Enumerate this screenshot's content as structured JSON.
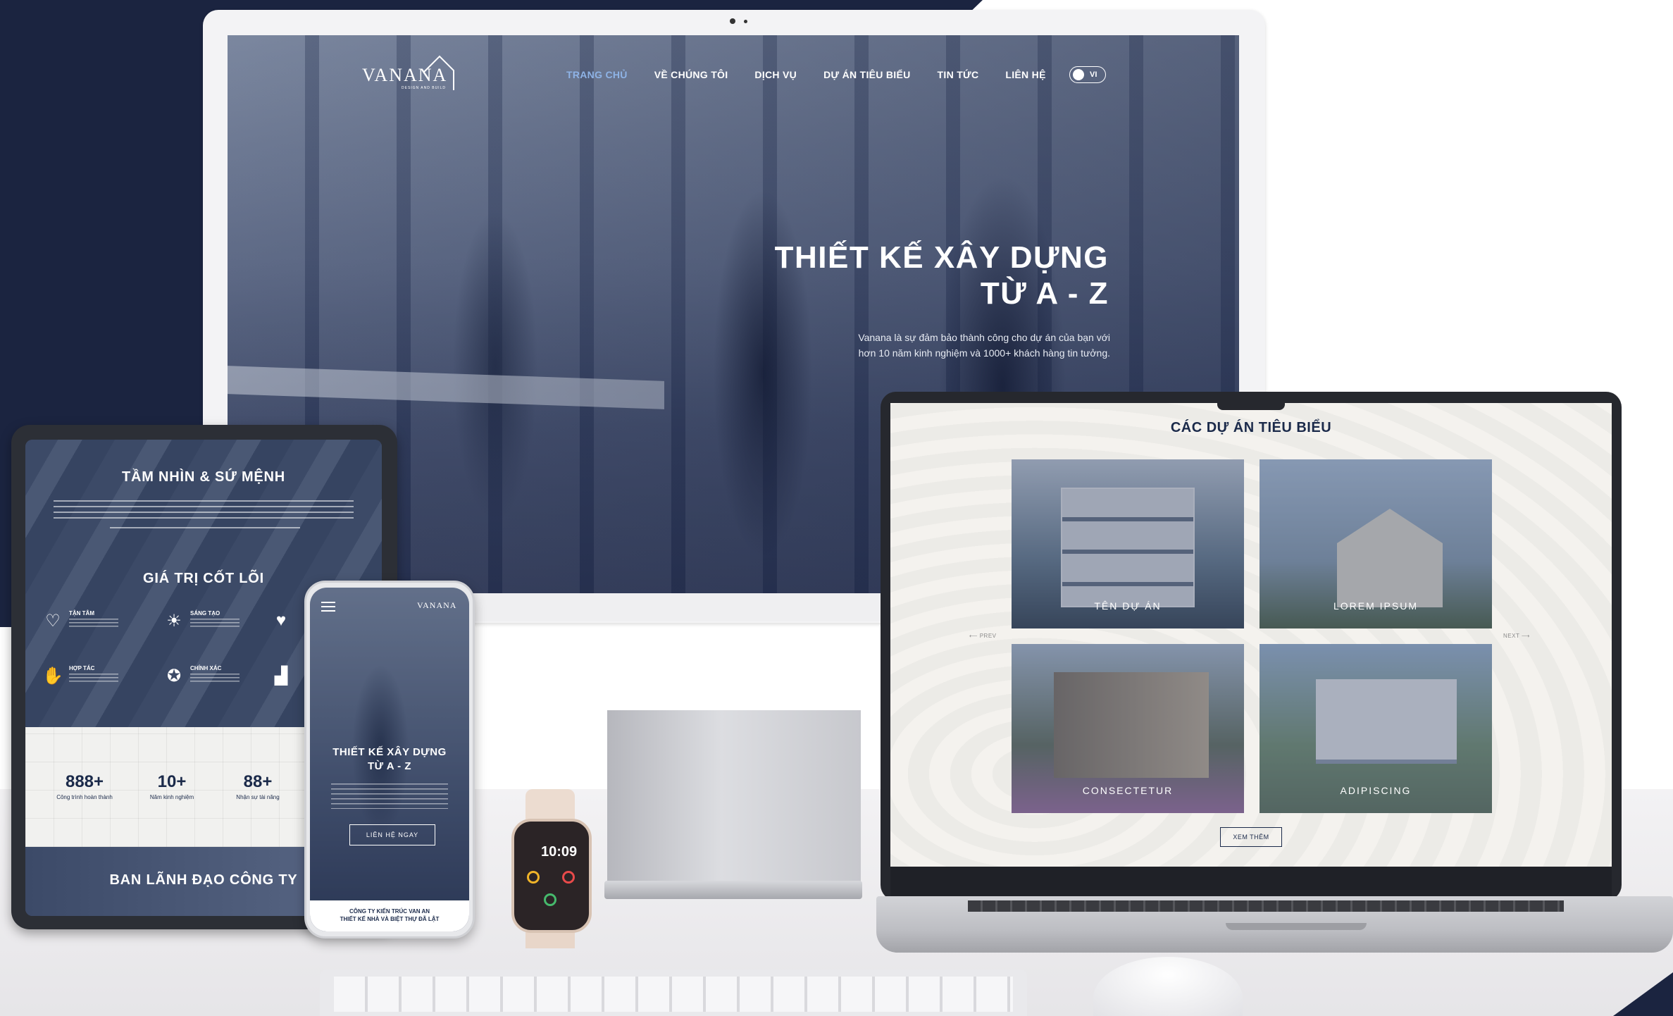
{
  "brand": {
    "logo_text": "VANANA",
    "logo_sub": "DESIGN AND BUILD",
    "navy": "#1b2440",
    "accent": "#8eb3e6"
  },
  "desktop": {
    "nav": [
      {
        "label": "TRANG CHỦ",
        "active": true
      },
      {
        "label": "VỀ CHÚNG TÔI",
        "active": false
      },
      {
        "label": "DỊCH VỤ",
        "active": false
      },
      {
        "label": "DỰ ÁN TIÊU BIỂU",
        "active": false
      },
      {
        "label": "TIN TỨC",
        "active": false
      },
      {
        "label": "LIÊN HỆ",
        "active": false
      }
    ],
    "language": "VI",
    "hero_title_line1": "THIẾT KẾ XÂY DỰNG",
    "hero_title_line2": "TỪ A - Z",
    "hero_desc_line1": "Vanana là sự đảm bảo thành công cho dự án của bạn với",
    "hero_desc_line2": "hơn 10 năm kinh nghiệm và 1000+ khách hàng tin tưởng."
  },
  "tablet": {
    "vision_title": "TẦM NHÌN & SỨ MỆNH",
    "core_title": "GIÁ TRỊ CỐT LÕI",
    "core_items": [
      {
        "label": "TẬN TÂM",
        "icon": "heart-hand-icon"
      },
      {
        "label": "SÁNG TẠO",
        "icon": "lightbulb-icon"
      },
      {
        "label": "HỢP TÁC",
        "icon": "handshake-icon"
      },
      {
        "label": "CHÍNH XÁC",
        "icon": "award-icon"
      }
    ],
    "stats": [
      {
        "value": "888+",
        "label": "Công trình hoàn thành"
      },
      {
        "value": "10+",
        "label": "Năm kinh nghiệm"
      },
      {
        "value": "88+",
        "label": "Nhận sự tài năng"
      }
    ],
    "leaders_title": "BAN LÃNH ĐẠO CÔNG TY"
  },
  "phone": {
    "logo_text": "VANANA",
    "hero_title_line1": "THIẾT KẾ XÂY DỰNG",
    "hero_title_line2": "TỪ A - Z",
    "cta": "LIÊN HỆ NGAY",
    "footer_line1": "CÔNG TY KIẾN TRÚC VAN AN",
    "footer_line2": "THIẾT KẾ NHÀ VÀ BIỆT THỰ ĐÃ LẬT"
  },
  "watch": {
    "time": "10:09"
  },
  "laptop": {
    "projects_title": "CÁC DỰ ÁN TIÊU BIỂU",
    "projects": [
      "TÊN DỰ ÁN",
      "LOREM IPSUM",
      "CONSECTETUR",
      "ADIPISCING"
    ],
    "prev_label": "PREV",
    "next_label": "NEXT",
    "more_label": "XEM THÊM"
  }
}
